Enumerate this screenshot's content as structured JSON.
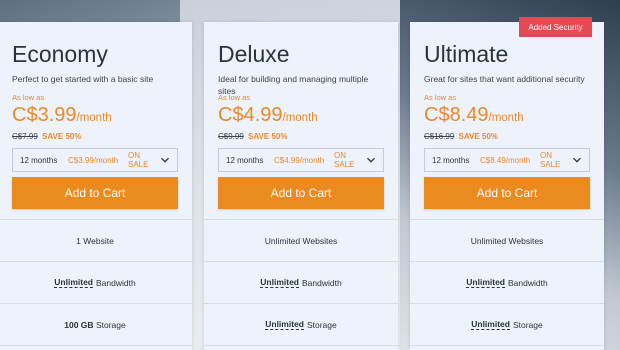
{
  "badge": "Added Security",
  "plans": [
    {
      "name": "Economy",
      "desc": "Perfect to get started with a basic site",
      "as_low": "As low as",
      "price": "C$3.99",
      "per": "/month",
      "old_price": "C$7.99",
      "save": "SAVE 50%",
      "term": "12 months",
      "term_price": "C$3.99/month",
      "on_sale": "ON SALE",
      "cart": "Add to Cart",
      "f1": "1 Website",
      "f2_strong": "Unlimited",
      "f2_rest": "Bandwidth",
      "f3_strong": "100 GB",
      "f3_rest": "Storage"
    },
    {
      "name": "Deluxe",
      "desc": "Ideal for building and managing multiple sites",
      "as_low": "As low as",
      "price": "C$4.99",
      "per": "/month",
      "old_price": "C$9.99",
      "save": "SAVE 50%",
      "term": "12 months",
      "term_price": "C$4.99/month",
      "on_sale": "ON SALE",
      "cart": "Add to Cart",
      "f1": "Unlimited Websites",
      "f2_strong": "Unlimited",
      "f2_rest": "Bandwidth",
      "f3_strong": "Unlimited",
      "f3_rest": "Storage"
    },
    {
      "name": "Ultimate",
      "desc": "Great for sites that want additional security",
      "as_low": "As low as",
      "price": "C$8.49",
      "per": "/month",
      "old_price": "C$16.99",
      "save": "SAVE 50%",
      "term": "12 months",
      "term_price": "C$8.49/month",
      "on_sale": "ON SALE",
      "cart": "Add to Cart",
      "f1": "Unlimited Websites",
      "f2_strong": "Unlimited",
      "f2_rest": "Bandwidth",
      "f3_strong": "Unlimited",
      "f3_rest": "Storage"
    }
  ]
}
